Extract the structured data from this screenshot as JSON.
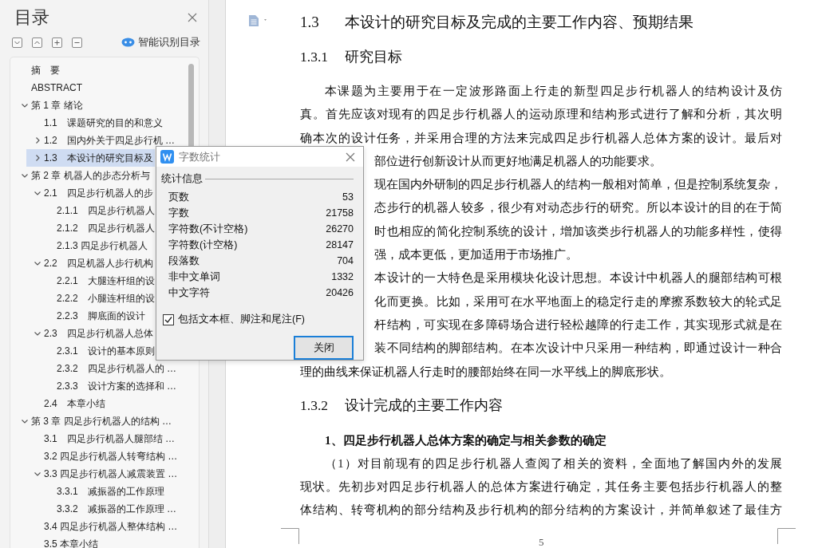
{
  "sidebar": {
    "title": "目录",
    "smart_label": "智能识别目录",
    "tree": [
      {
        "text": "摘　要",
        "selected": false
      },
      {
        "text": "ABSTRACT",
        "selected": false
      },
      {
        "text": "第 1 章  绪论",
        "selected": false,
        "expanded": true,
        "children": [
          {
            "text": "1.1　课题研究的目的和意义",
            "selected": false
          },
          {
            "text": "1.2　国内外关于四足步行机 …",
            "selected": false,
            "expanded": false
          },
          {
            "text": "1.3　本设计的研究目标及",
            "selected": true,
            "expanded": false
          }
        ]
      },
      {
        "text": "第 2 章  机器人的步态分析与",
        "selected": false,
        "expanded": true,
        "children": [
          {
            "text": "2.1　四足步行机器人的步",
            "selected": false,
            "expanded": true,
            "children": [
              {
                "text": "2.1.1　四足步行机器人",
                "selected": false
              },
              {
                "text": "2.1.2　四足步行机器人",
                "selected": false
              },
              {
                "text": "2.1.3 四足步行机器人",
                "selected": false
              }
            ]
          },
          {
            "text": "2.2　四足机器人步行机构",
            "selected": false,
            "expanded": true,
            "children": [
              {
                "text": "2.2.1　大腿连杆组的设",
                "selected": false
              },
              {
                "text": "2.2.2　小腿连杆组的设",
                "selected": false
              },
              {
                "text": "2.2.3　脚底面的设计",
                "selected": false
              }
            ]
          },
          {
            "text": "2.3　四足步行机器人总体",
            "selected": false,
            "expanded": true,
            "children": [
              {
                "text": "2.3.1　设计的基本原则",
                "selected": false
              },
              {
                "text": "2.3.2　四足步行机器人的 …",
                "selected": false
              },
              {
                "text": "2.3.3　设计方案的选择和 …",
                "selected": false
              }
            ]
          },
          {
            "text": "2.4　本章小结",
            "selected": false
          }
        ]
      },
      {
        "text": "第 3 章  四足步行机器人的结构 …",
        "selected": false,
        "expanded": true,
        "children": [
          {
            "text": "3.1　四足步行机器人腿部结 …",
            "selected": false
          },
          {
            "text": "3.2 四足步行机器人转弯结构 …",
            "selected": false
          },
          {
            "text": "3.3 四足步行机器人减震装置 …",
            "selected": false,
            "expanded": true,
            "children": [
              {
                "text": "3.3.1　减振器的工作原理",
                "selected": false
              },
              {
                "text": "3.3.2　减振器的工作原理 …",
                "selected": false
              }
            ]
          },
          {
            "text": "3.4 四足步行机器人整体结构 …",
            "selected": false
          },
          {
            "text": "3.5  本章小结",
            "selected": false
          }
        ]
      }
    ]
  },
  "document": {
    "blocks": [
      {
        "kind": "h1",
        "number": "1.3",
        "text": "本设计的研究目标及完成的主要工作内容、预期结果"
      },
      {
        "kind": "h2",
        "number": "1.3.1",
        "text": "研究目标"
      },
      {
        "kind": "indent",
        "text": "本课题为主要用于在一定波形路面上行走的新型四足步行机器人的结构设计及仿"
      },
      {
        "kind": "full",
        "text": "真。首先应该对现有的四足步行机器人的运动原理和结构形式进行了解和分析，其次明"
      },
      {
        "kind": "full",
        "text": "确本次的设计任务，并采用合理的方法来完成四足步行机器人总体方案的设计。最后对"
      },
      {
        "kind": "covered_end",
        "text": "部位进行创新设计从而更好地满足机器人的功能要求。"
      },
      {
        "kind": "covered",
        "text": "现在国内外研制的四足步行机器人的结构一般相对简单，但是控制系统复杂，"
      },
      {
        "kind": "covered",
        "text": "态步行的机器人较多，很少有对动态步行的研究。所以本设计的目的在于简"
      },
      {
        "kind": "covered",
        "text": "时也相应的简化控制系统的设计，增加该类步行机器人的功能多样性，使得"
      },
      {
        "kind": "covered_end",
        "text": "强，成本更低，更加适用于市场推广。"
      },
      {
        "kind": "covered",
        "text": "本设计的一大特色是采用模块化设计思想。本设计中机器人的腿部结构可根"
      },
      {
        "kind": "covered",
        "text": "化而更换。比如，采用可在水平地面上的稳定行走的摩擦系数较大的轮式足"
      },
      {
        "kind": "covered",
        "text": "杆结构，可实现在多障碍场合进行轻松越障的行走工作，其实现形式就是在"
      },
      {
        "kind": "covered",
        "text": "装不同结构的脚部结构。在本次设计中只采用一种结构，即通过设计一种合"
      },
      {
        "kind": "end",
        "text": "理的曲线来保证机器人行走时的腰部始终在同一水平线上的脚底形状。"
      },
      {
        "kind": "h3",
        "number": "1.3.2",
        "text": "设计完成的主要工作内容"
      },
      {
        "kind": "sub",
        "text": "1、四足步行机器人总体方案的确定与相关参数的确定"
      },
      {
        "kind": "indent",
        "text": "（1）对目前现有的四足步行机器人查阅了相关的资料，全面地了解国内外的发展"
      },
      {
        "kind": "full",
        "text": "现状。先初步对四足步行机器人的总体方案进行确定，其任务主要包括步行机器人的整"
      },
      {
        "kind": "full",
        "text": "体结构、转弯机构的部分结构及步行机构的部分结构的方案设计，并简单叙述了最佳方"
      }
    ],
    "page_number": "5"
  },
  "dialog": {
    "title": "字数统计",
    "group": "统计信息",
    "stats": [
      {
        "label": "页数",
        "value": "53"
      },
      {
        "label": "字数",
        "value": "21758"
      },
      {
        "label": "字符数(不计空格)",
        "value": "26270"
      },
      {
        "label": "字符数(计空格)",
        "value": "28147"
      },
      {
        "label": "段落数",
        "value": "704"
      },
      {
        "label": "非中文单词",
        "value": "1332"
      },
      {
        "label": "中文字符",
        "value": "20426"
      }
    ],
    "option": {
      "label": "包括文本框、脚注和尾注(F)",
      "checked": true
    },
    "button": "关闭"
  }
}
